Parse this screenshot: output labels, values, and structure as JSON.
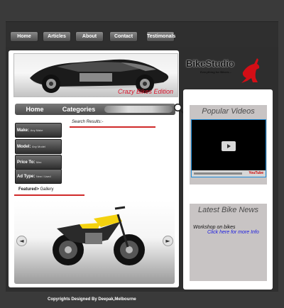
{
  "nav": {
    "items": [
      {
        "label": "Home"
      },
      {
        "label": "Articles"
      },
      {
        "label": "About"
      },
      {
        "label": "Contact"
      },
      {
        "label": "Testimonals"
      }
    ]
  },
  "banner": {
    "caption": "Crazy Bikes Edition"
  },
  "logo": {
    "title": "BikeStudio",
    "tagline": "Everything for Bikers..."
  },
  "search": {
    "tabs": [
      "Home",
      "Categories"
    ],
    "input_value": ""
  },
  "filters": [
    {
      "label": "Make:",
      "value": "Any Make"
    },
    {
      "label": "Model:",
      "value": "Any Model"
    },
    {
      "label": "Price To:",
      "value": "Max"
    },
    {
      "label": "Ad Type:",
      "value": "New / Used"
    }
  ],
  "results": {
    "label": "Search Results:-"
  },
  "featured": {
    "prefix": "Featured>",
    "suffix": "Gallery"
  },
  "gallery": {
    "prev_glyph": "◄",
    "next_glyph": "►"
  },
  "sidebar": {
    "videos_heading": "Popular Videos",
    "news_heading": "Latest Bike News",
    "news_item": "Workshop on bikes",
    "news_link": "Click here for more Info",
    "video_brand": "YouTube"
  },
  "footer": {
    "text": "Copyrights Designed By Deepak,Melbourne"
  },
  "colors": {
    "accent_red": "#d02a2a",
    "caption_red": "#d8142b",
    "link_blue": "#1a1ae0",
    "video_border": "#1e8cd9"
  }
}
